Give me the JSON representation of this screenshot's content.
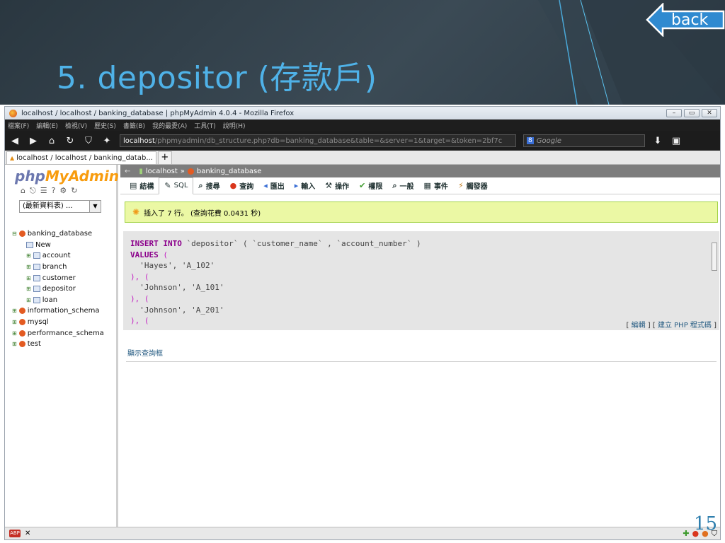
{
  "slide": {
    "title": "5. depositor (存款戶)",
    "back_label": "back",
    "page_number": "15"
  },
  "browser": {
    "window_title": "localhost / localhost / banking_database | phpMyAdmin 4.0.4 - Mozilla Firefox",
    "menu": [
      "檔案(F)",
      "編輯(E)",
      "檢視(V)",
      "歷史(S)",
      "書籤(B)",
      "我的最愛(A)",
      "工具(T)",
      "說明(H)"
    ],
    "url_host": "localhost",
    "url_path": "/phpmyadmin/db_structure.php?db=banking_database&table=&server=1&target=&token=2bf7c",
    "search_placeholder": "Google",
    "tab_label": "localhost / localhost / banking_datab..."
  },
  "pma": {
    "logo_a": "php",
    "logo_b": "MyAdmin",
    "recent_select": "(最新資料表) ...",
    "tree": [
      {
        "label": "banking_database",
        "kind": "db",
        "indent": 0
      },
      {
        "label": "New",
        "kind": "new",
        "indent": 1
      },
      {
        "label": "account",
        "kind": "table",
        "indent": 1
      },
      {
        "label": "branch",
        "kind": "table",
        "indent": 1
      },
      {
        "label": "customer",
        "kind": "table",
        "indent": 1
      },
      {
        "label": "depositor",
        "kind": "table",
        "indent": 1
      },
      {
        "label": "loan",
        "kind": "table",
        "indent": 1
      },
      {
        "label": "information_schema",
        "kind": "db",
        "indent": 0
      },
      {
        "label": "mysql",
        "kind": "db",
        "indent": 0
      },
      {
        "label": "performance_schema",
        "kind": "db",
        "indent": 0
      },
      {
        "label": "test",
        "kind": "db",
        "indent": 0
      }
    ],
    "breadcrumb": {
      "server": "localhost",
      "sep": "»",
      "database": "banking_database"
    },
    "tabs": [
      "結構",
      "SQL",
      "搜尋",
      "查詢",
      "匯出",
      "輸入",
      "操作",
      "權限",
      "一般",
      "事件",
      "觸發器"
    ],
    "active_tab": "SQL",
    "success_message": "插入了 7 行。 (查詢花費 0.0431 秒)",
    "sql": {
      "line1_kw": "INSERT INTO",
      "line1_rest": " `depositor` ( `customer_name` , `account_number` )",
      "line2_kw": "VALUES",
      "line2_rest": " (",
      "v1": "  'Hayes', 'A_102'",
      "sep1": "), (",
      "v2": "  'Johnson', 'A_101'",
      "sep2": "), (",
      "v3": "  'Johnson', 'A_201'",
      "sep3": "), ("
    },
    "sql_links": {
      "edit": "編輯",
      "create_php": "建立 PHP 程式碼"
    },
    "show_query_box": "顯示查詢框"
  }
}
